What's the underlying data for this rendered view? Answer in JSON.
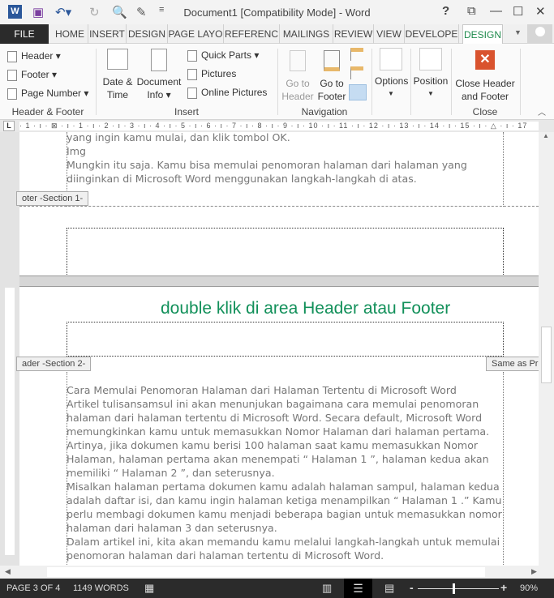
{
  "window": {
    "title": "Document1 [Compatibility Mode] - Word",
    "help": "?",
    "minimize": "—",
    "maximize": "☐",
    "close": "✕"
  },
  "tabs": [
    {
      "label": "FILE"
    },
    {
      "label": "HOME"
    },
    {
      "label": "INSERT"
    },
    {
      "label": "DESIGN"
    },
    {
      "label": "PAGE LAYO"
    },
    {
      "label": "REFERENC"
    },
    {
      "label": "MAILINGS"
    },
    {
      "label": "REVIEW"
    },
    {
      "label": "VIEW"
    },
    {
      "label": "DEVELOPE"
    },
    {
      "label": "DESIGN",
      "active": true
    }
  ],
  "ribbon": {
    "header_footer": {
      "header": "Header",
      "footer": "Footer",
      "page_number": "Page Number",
      "group": "Header & Footer"
    },
    "insert": {
      "date1": "Date &",
      "date2": "Time",
      "doc1": "Document",
      "doc2": "Info",
      "quick_parts": "Quick Parts",
      "pictures": "Pictures",
      "online_pictures": "Online Pictures",
      "group": "Insert"
    },
    "navigation": {
      "goh1": "Go to",
      "goh2": "Header",
      "gof1": "Go to",
      "gof2": "Footer",
      "group": "Navigation"
    },
    "options": {
      "label": "Options"
    },
    "position": {
      "label": "Position"
    },
    "close": {
      "l1": "Close Header",
      "l2": "and Footer",
      "group": "Close"
    }
  },
  "ruler": {
    "text": "· 1 · ı · ⊠ · ı · 1 · ı · 2 · ı · 3 · ı · 4 · ı · 5 · ı · 6 · ı · 7 · ı · 8 · ı · 9 · ı · 10 · ı · 11 · ı · 12 · ı · 13 · ı · 14 · ı · 15 · ı · △ · ı · 17"
  },
  "document": {
    "top_lines": [
      "yang ingin kamu mulai, dan klik tombol OK.",
      "Img",
      "Mungkin itu saja. Kamu bisa memulai penomoran halaman dari halaman yang",
      "diinginkan di Microsoft Word menggunakan langkah-langkah di atas."
    ],
    "footer_section1": "oter -Section 1-",
    "annotation": "double klik di area Header atau Footer",
    "annotation_color": "#12905a",
    "header_section2": "ader -Section 2-",
    "same_as_previous": "Same as Pre",
    "body_lines": [
      "Cara Memulai Penomoran Halaman dari Halaman Tertentu di Microsoft Word",
      "Artikel tulisansamsul ini akan menunjukan bagaimana cara memulai penomoran",
      "halaman dari halaman tertentu di Microsoft Word. Secara default, Microsoft Word",
      "memungkinkan kamu untuk memasukkan Nomor Halaman dari halaman pertama.",
      "Artinya, jika dokumen kamu berisi 100 halaman saat kamu memasukkan Nomor",
      "Halaman, halaman pertama akan menempati “ Halaman 1 ”, halaman kedua akan",
      "memiliki “ Halaman 2 ”, dan seterusnya.",
      "Misalkan halaman pertama dokumen kamu adalah halaman sampul, halaman kedua",
      "adalah daftar isi, dan kamu ingin halaman ketiga menampilkan “ Halaman 1 .” Kamu",
      "perlu membagi dokumen kamu menjadi beberapa bagian untuk memasukkan nomor",
      "halaman dari halaman 3 dan seterusnya.",
      "Dalam artikel ini, kita akan memandu kamu melalui langkah-langkah untuk memulai",
      "penomoran halaman dari halaman tertentu di Microsoft Word."
    ]
  },
  "status": {
    "page": "PAGE 3 OF 4",
    "words": "1149 WORDS",
    "zoom": "90%",
    "zoom_minus": "-",
    "zoom_plus": "+"
  }
}
